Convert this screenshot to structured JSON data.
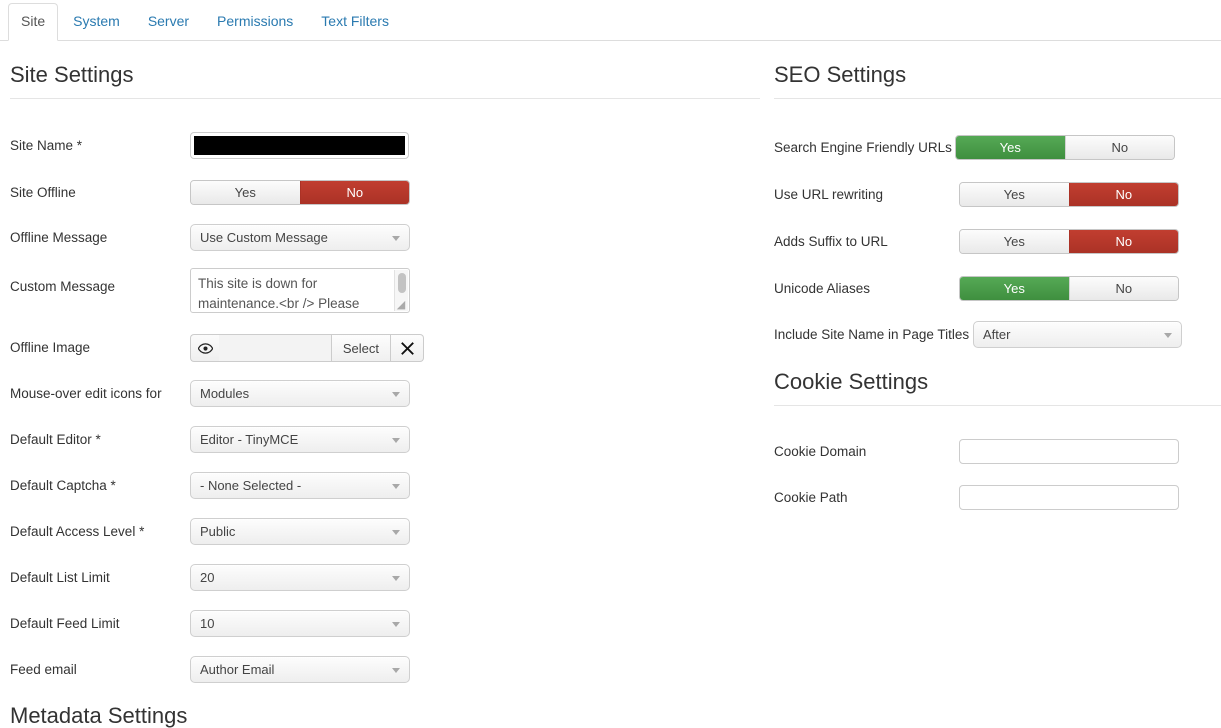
{
  "tabs": [
    {
      "label": "Site",
      "active": true
    },
    {
      "label": "System",
      "active": false
    },
    {
      "label": "Server",
      "active": false
    },
    {
      "label": "Permissions",
      "active": false
    },
    {
      "label": "Text Filters",
      "active": false
    }
  ],
  "site_settings": {
    "title": "Site Settings",
    "site_name": {
      "label": "Site Name *",
      "value": "",
      "redacted": true
    },
    "site_offline": {
      "label": "Site Offline",
      "yes": "Yes",
      "no": "No",
      "selected": "No"
    },
    "offline_message": {
      "label": "Offline Message",
      "value": "Use Custom Message"
    },
    "custom_message": {
      "label": "Custom Message",
      "value": "This site is down for maintenance.<br /> Please check back again soon."
    },
    "offline_image": {
      "label": "Offline Image",
      "value": "",
      "select_label": "Select",
      "preview_icon": "eye-icon",
      "clear_icon": "close-x-icon"
    },
    "mouseover_edit_icons": {
      "label": "Mouse-over edit icons for",
      "value": "Modules"
    },
    "default_editor": {
      "label": "Default Editor *",
      "value": "Editor - TinyMCE"
    },
    "default_captcha": {
      "label": "Default Captcha *",
      "value": "- None Selected -"
    },
    "default_access_level": {
      "label": "Default Access Level *",
      "value": "Public"
    },
    "default_list_limit": {
      "label": "Default List Limit",
      "value": "20"
    },
    "default_feed_limit": {
      "label": "Default Feed Limit",
      "value": "10"
    },
    "feed_email": {
      "label": "Feed email",
      "value": "Author Email"
    },
    "next_section_title": "Metadata Settings"
  },
  "seo_settings": {
    "title": "SEO Settings",
    "rows": [
      {
        "label": "Search Engine Friendly URLs",
        "yes": "Yes",
        "no": "No",
        "selected": "Yes"
      },
      {
        "label": "Use URL rewriting",
        "yes": "Yes",
        "no": "No",
        "selected": "No"
      },
      {
        "label": "Adds Suffix to URL",
        "yes": "Yes",
        "no": "No",
        "selected": "No"
      },
      {
        "label": "Unicode Aliases",
        "yes": "Yes",
        "no": "No",
        "selected": "Yes"
      }
    ],
    "include_site_name": {
      "label": "Include Site Name in Page Titles",
      "value": "After"
    }
  },
  "cookie_settings": {
    "title": "Cookie Settings",
    "cookie_domain": {
      "label": "Cookie Domain",
      "value": ""
    },
    "cookie_path": {
      "label": "Cookie Path",
      "value": ""
    }
  },
  "colors": {
    "link": "#2a7ab0",
    "toggle_yes_on": "#47a047",
    "toggle_no_on": "#bb3a2c",
    "text": "#333333",
    "border": "#cccccc"
  }
}
